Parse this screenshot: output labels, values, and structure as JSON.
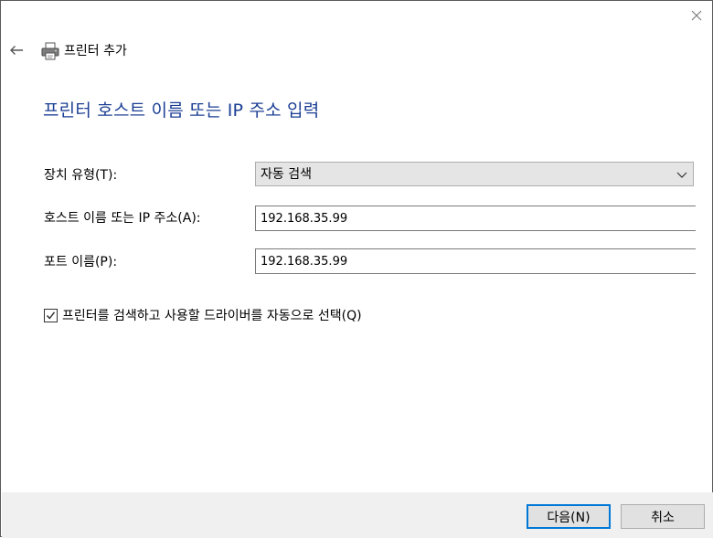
{
  "window": {
    "title": "프린터 추가",
    "close_icon": "close-icon",
    "back_icon": "back-arrow-icon",
    "app_icon": "printer-icon"
  },
  "page": {
    "heading": "프린터 호스트 이름 또는 IP 주소 입력"
  },
  "form": {
    "device_type": {
      "label": "장치 유형(T):",
      "value": "자동 검색"
    },
    "host": {
      "label": "호스트 이름 또는 IP 주소(A):",
      "value": "192.168.35.99"
    },
    "port": {
      "label": "포트 이름(P):",
      "value": "192.168.35.99"
    },
    "auto_driver": {
      "label": "프린터를 검색하고 사용할 드라이버를 자동으로 선택(Q)",
      "checked": true
    }
  },
  "footer": {
    "next_label": "다음(N)",
    "cancel_label": "취소"
  },
  "colors": {
    "heading": "#1c3f94",
    "primary_border": "#0078d7",
    "footer_bg": "#f0f0f0"
  }
}
